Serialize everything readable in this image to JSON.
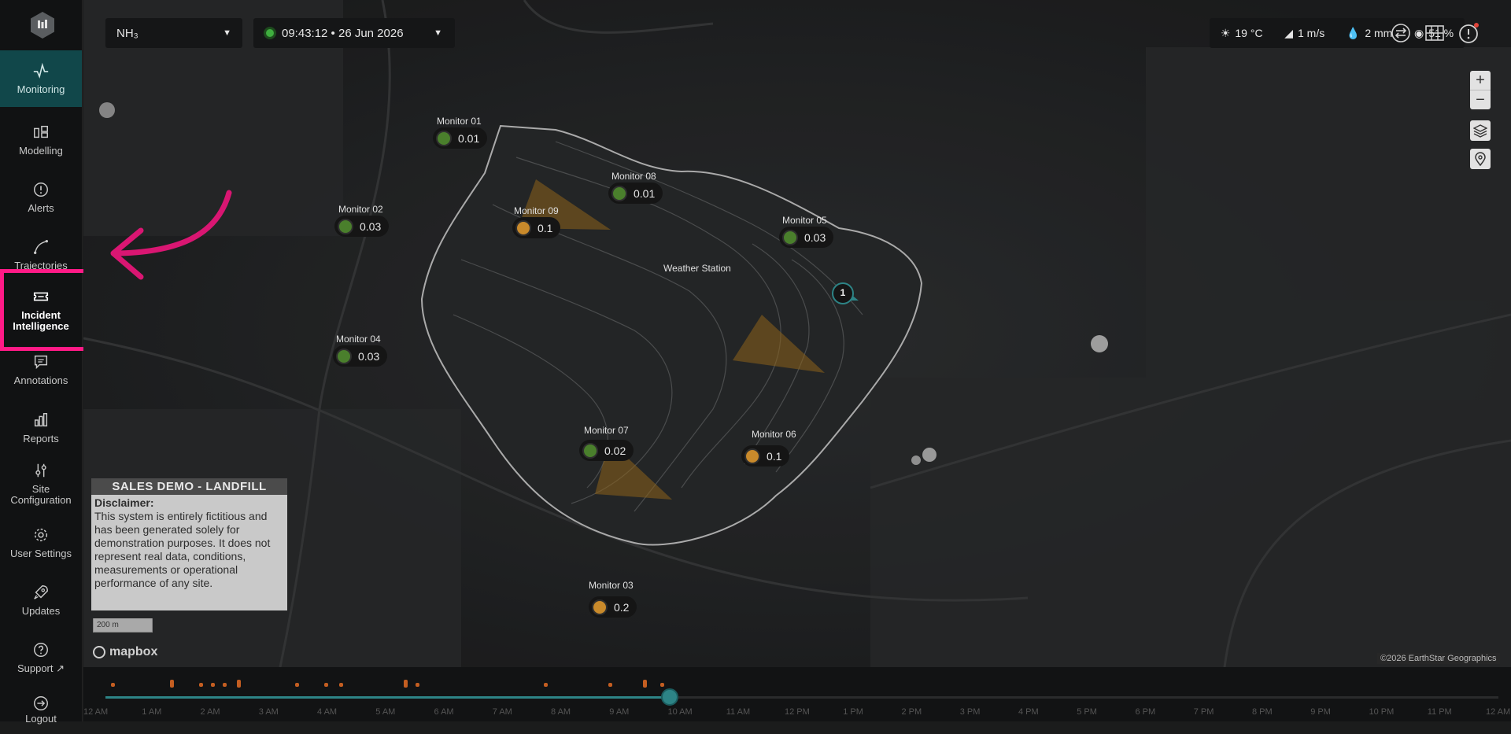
{
  "sidebar": {
    "items": [
      {
        "label": "Monitoring",
        "icon": "pulse-icon"
      },
      {
        "label": "Modelling",
        "icon": "grid-layers-icon"
      },
      {
        "label": "Alerts",
        "icon": "alert-circle-icon"
      },
      {
        "label": "Trajectories",
        "icon": "trajectory-icon"
      },
      {
        "label": "Incident\nIntelligence",
        "icon": "ticket-icon"
      },
      {
        "label": "Annotations",
        "icon": "comment-icon"
      },
      {
        "label": "Reports",
        "icon": "bar-chart-icon"
      },
      {
        "label": "Site\nConfiguration",
        "icon": "sliders-icon"
      },
      {
        "label": "User Settings",
        "icon": "gear-icon"
      },
      {
        "label": "Updates",
        "icon": "rocket-icon"
      },
      {
        "label": "Support",
        "icon": "help-circle-icon"
      },
      {
        "label": "Logout",
        "icon": "logout-icon"
      }
    ]
  },
  "topbar": {
    "gas_selected": "NH₃",
    "datetime": "09:43:12 • 26 Jun 2026",
    "weather": {
      "temperature": "19 °C",
      "wind": "1 m/s",
      "rain": "2 mm",
      "humidity": "51 %"
    }
  },
  "monitors": [
    {
      "name": "Monitor 01",
      "value": "0.01",
      "status": "green"
    },
    {
      "name": "Monitor 08",
      "value": "0.01",
      "status": "green"
    },
    {
      "name": "Monitor 02",
      "value": "0.03",
      "status": "green"
    },
    {
      "name": "Monitor 09",
      "value": "0.1",
      "status": "orange"
    },
    {
      "name": "Monitor 05",
      "value": "0.03",
      "status": "green"
    },
    {
      "name": "Monitor 04",
      "value": "0.03",
      "status": "green"
    },
    {
      "name": "Monitor 07",
      "value": "0.02",
      "status": "green"
    },
    {
      "name": "Monitor 06",
      "value": "0.1",
      "status": "orange"
    },
    {
      "name": "Monitor 03",
      "value": "0.2",
      "status": "orange"
    }
  ],
  "weather_station": {
    "label": "Weather Station",
    "count": "1"
  },
  "disclaimer": {
    "site_title": "SALES DEMO - LANDFILL",
    "heading": "Disclaimer:",
    "text": "This system is entirely fictitious and has been generated solely for demonstration purposes. It does not represent real data, conditions, measurements or operational performance of any site."
  },
  "map": {
    "scale": "200 m",
    "logo": "mapbox",
    "attribution": "©2026 EarthStar Geographics",
    "zoom_in": "+",
    "zoom_out": "−"
  },
  "timeline": {
    "ticks": [
      "12 AM",
      "1 AM",
      "2 AM",
      "3 AM",
      "4 AM",
      "5 AM",
      "6 AM",
      "7 AM",
      "8 AM",
      "9 AM",
      "10 AM",
      "11 AM",
      "12 PM",
      "1 PM",
      "2 PM",
      "3 PM",
      "4 PM",
      "5 PM",
      "6 PM",
      "7 PM",
      "8 PM",
      "9 PM",
      "10 PM",
      "11 PM",
      "12 AM"
    ],
    "current_hour": 9.72,
    "events_hours": [
      0.1,
      1.1,
      1.6,
      1.8,
      2.0,
      2.25,
      3.25,
      3.75,
      4.0,
      5.1,
      5.3,
      7.5,
      8.6,
      9.2,
      9.5
    ]
  },
  "colors": {
    "accent": "#2d8486",
    "highlight": "#ff1a86",
    "status_green": "#4a7f2c",
    "status_orange": "#c98a2b"
  }
}
